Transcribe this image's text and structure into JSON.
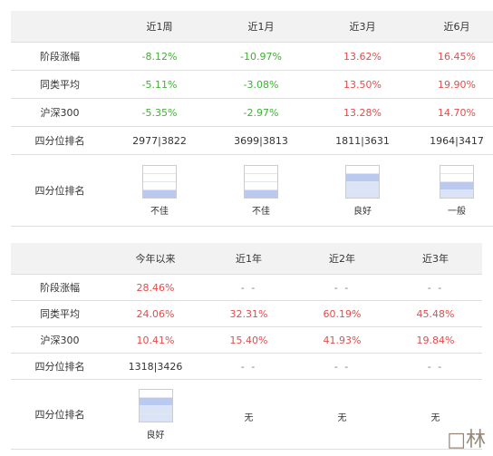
{
  "table1": {
    "headers": [
      "",
      "近1周",
      "近1月",
      "近3月",
      "近6月"
    ],
    "rows": [
      {
        "label": "阶段涨幅",
        "cells": [
          {
            "v": "-8.12%",
            "c": "neg"
          },
          {
            "v": "-10.97%",
            "c": "neg"
          },
          {
            "v": "13.62%",
            "c": "pos"
          },
          {
            "v": "16.45%",
            "c": "pos"
          }
        ]
      },
      {
        "label": "同类平均",
        "cells": [
          {
            "v": "-5.11%",
            "c": "neg"
          },
          {
            "v": "-3.08%",
            "c": "neg"
          },
          {
            "v": "13.50%",
            "c": "pos"
          },
          {
            "v": "19.90%",
            "c": "pos"
          }
        ]
      },
      {
        "label": "沪深300",
        "cells": [
          {
            "v": "-5.35%",
            "c": "neg"
          },
          {
            "v": "-2.97%",
            "c": "neg"
          },
          {
            "v": "13.28%",
            "c": "pos"
          },
          {
            "v": "14.70%",
            "c": "pos"
          }
        ]
      },
      {
        "label": "四分位排名",
        "cells": [
          {
            "v": "2977|3822",
            "c": ""
          },
          {
            "v": "3699|3813",
            "c": ""
          },
          {
            "v": "1811|3631",
            "c": ""
          },
          {
            "v": "1964|3417",
            "c": ""
          }
        ]
      }
    ],
    "quartile_label": "四分位排名",
    "quartiles": [
      {
        "text": "不佳",
        "level": 1
      },
      {
        "text": "不佳",
        "level": 1
      },
      {
        "text": "良好",
        "level": 3
      },
      {
        "text": "一般",
        "level": 2
      }
    ]
  },
  "table2": {
    "headers": [
      "",
      "今年以来",
      "近1年",
      "近2年",
      "近3年"
    ],
    "rows": [
      {
        "label": "阶段涨幅",
        "cells": [
          {
            "v": "28.46%",
            "c": "pos"
          },
          {
            "v": "- -",
            "c": "dash"
          },
          {
            "v": "- -",
            "c": "dash"
          },
          {
            "v": "- -",
            "c": "dash"
          }
        ]
      },
      {
        "label": "同类平均",
        "cells": [
          {
            "v": "24.06%",
            "c": "pos"
          },
          {
            "v": "32.31%",
            "c": "pos"
          },
          {
            "v": "60.19%",
            "c": "pos"
          },
          {
            "v": "45.48%",
            "c": "pos"
          }
        ]
      },
      {
        "label": "沪深300",
        "cells": [
          {
            "v": "10.41%",
            "c": "pos"
          },
          {
            "v": "15.40%",
            "c": "pos"
          },
          {
            "v": "41.93%",
            "c": "pos"
          },
          {
            "v": "19.84%",
            "c": "pos"
          }
        ]
      },
      {
        "label": "四分位排名",
        "cells": [
          {
            "v": "1318|3426",
            "c": ""
          },
          {
            "v": "- -",
            "c": "dash"
          },
          {
            "v": "- -",
            "c": "dash"
          },
          {
            "v": "- -",
            "c": "dash"
          }
        ]
      }
    ],
    "quartile_label": "四分位排名",
    "quartiles": [
      {
        "text": "良好",
        "level": 3
      },
      {
        "text": "无",
        "level": 0
      },
      {
        "text": "无",
        "level": 0
      },
      {
        "text": "无",
        "level": 0
      }
    ]
  },
  "watermark": "□林",
  "colors": {
    "positive": "#e34c4c",
    "negative": "#3fb033",
    "header_bg": "#f2f2f2",
    "quartile_fill": "#b9c9f0"
  }
}
